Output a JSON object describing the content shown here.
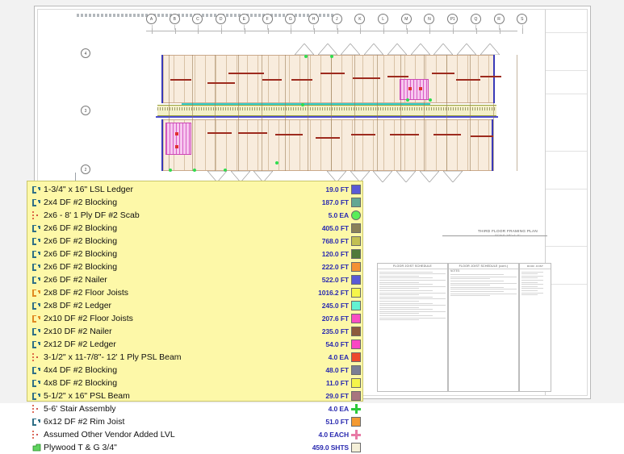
{
  "sheet": {
    "header_note": "",
    "plan_title": "THIRD FLOOR FRAMING PLAN",
    "plan_scale": "SCALE 1/8\"=1'-0\"",
    "grid_labels_horizontal": [
      "A",
      "B",
      "C",
      "D",
      "E",
      "F",
      "G",
      "H",
      "J",
      "K",
      "L",
      "M",
      "N",
      "P1",
      "Q",
      "R",
      "S"
    ],
    "grid_labels_vertical": [
      "4",
      "3",
      "2"
    ],
    "schedules": [
      {
        "title": "FLOOR JOIST SCHEDULE"
      },
      {
        "title": "FLOOR JOIST SCHEDULE (cont.)"
      },
      {
        "title": "ROOF JOIST"
      }
    ],
    "notes_heading": "NOTES:"
  },
  "legend": {
    "panel_title": "",
    "rows": [
      {
        "icon": "linear-member-icon",
        "icon_style": "line",
        "label": "1-3/4\" x 16\" LSL Ledger",
        "value": "19.0 FT",
        "swatch": "#5a5ad6",
        "swatch_shape": "square"
      },
      {
        "icon": "linear-member-icon",
        "icon_style": "line",
        "label": "2x4 DF #2 Blocking",
        "value": "187.0 FT",
        "swatch": "#63a893",
        "swatch_shape": "square"
      },
      {
        "icon": "point-member-icon",
        "icon_style": "point",
        "label": "2x6 - 8' 1 Ply DF #2 Scab",
        "value": "5.0 EA",
        "swatch": "#58ee58",
        "swatch_shape": "circle"
      },
      {
        "icon": "linear-member-icon",
        "icon_style": "line",
        "label": "2x6 DF #2 Blocking",
        "value": "405.0 FT",
        "swatch": "#8a8158",
        "swatch_shape": "square"
      },
      {
        "icon": "linear-member-icon",
        "icon_style": "line",
        "label": "2x6 DF #2 Blocking",
        "value": "768.0 FT",
        "swatch": "#c2bf52",
        "swatch_shape": "square"
      },
      {
        "icon": "linear-member-icon",
        "icon_style": "line",
        "label": "2x6 DF #2 Blocking",
        "value": "120.0 FT",
        "swatch": "#4f7a3a",
        "swatch_shape": "square"
      },
      {
        "icon": "linear-member-icon",
        "icon_style": "line",
        "label": "2x6 DF #2 Blocking",
        "value": "222.0 FT",
        "swatch": "#f49133",
        "swatch_shape": "square"
      },
      {
        "icon": "linear-member-icon",
        "icon_style": "line",
        "label": "2x6 DF #2 Nailer",
        "value": "522.0 FT",
        "swatch": "#5a5ad6",
        "swatch_shape": "square"
      },
      {
        "icon": "linear-member-icon",
        "icon_style": "line-orange",
        "label": "2x8 DF #2 Floor Joists",
        "value": "1016.2 FT",
        "swatch": "#f6f64a",
        "swatch_shape": "square"
      },
      {
        "icon": "linear-member-icon",
        "icon_style": "line",
        "label": "2x8 DF #2 Ledger",
        "value": "245.0 FT",
        "swatch": "#63f2d2",
        "swatch_shape": "square"
      },
      {
        "icon": "linear-member-icon",
        "icon_style": "line-orange",
        "label": "2x10 DF #2 Floor Joists",
        "value": "207.6 FT",
        "swatch": "#f94ec2",
        "swatch_shape": "square"
      },
      {
        "icon": "linear-member-icon",
        "icon_style": "line",
        "label": "2x10 DF #2 Nailer",
        "value": "235.0 FT",
        "swatch": "#8d5a3c",
        "swatch_shape": "square"
      },
      {
        "icon": "linear-member-icon",
        "icon_style": "line",
        "label": "2x12 DF #2 Ledger",
        "value": "54.0 FT",
        "swatch": "#fa46c4",
        "swatch_shape": "square"
      },
      {
        "icon": "point-member-icon",
        "icon_style": "point",
        "label": "3-1/2\" x 11-7/8\"- 12' 1 Ply PSL Beam",
        "value": "4.0 EA",
        "swatch": "#ee4a2c",
        "swatch_shape": "square"
      },
      {
        "icon": "linear-member-icon",
        "icon_style": "line",
        "label": "4x4 DF #2 Blocking",
        "value": "48.0 FT",
        "swatch": "#7b7f94",
        "swatch_shape": "square"
      },
      {
        "icon": "linear-member-icon",
        "icon_style": "line",
        "label": "4x8 DF #2 Blocking",
        "value": "11.0 FT",
        "swatch": "#f4f44a",
        "swatch_shape": "square"
      },
      {
        "icon": "linear-member-icon",
        "icon_style": "line",
        "label": "5-1/2\" x 16\" PSL Beam",
        "value": "29.0 FT",
        "swatch": "#a8757e",
        "swatch_shape": "square"
      },
      {
        "icon": "point-member-icon",
        "icon_style": "point",
        "label": "5-6' Stair Assembly",
        "value": "4.0 EA",
        "swatch": "#2cc93a",
        "swatch_shape": "cross"
      },
      {
        "icon": "linear-member-icon",
        "icon_style": "line",
        "label": "6x12 DF #2 Rim Joist",
        "value": "51.0 FT",
        "swatch": "#f49a33",
        "swatch_shape": "square"
      },
      {
        "icon": "point-member-icon",
        "icon_style": "point",
        "label": "Assumed Other Vendor Added LVL",
        "value": "4.0 EACH",
        "swatch": "#e87aa6",
        "swatch_shape": "cross"
      },
      {
        "icon": "area-member-icon",
        "icon_style": "area",
        "label": "Plywood T & G 3/4\"",
        "value": "459.0 SHTS",
        "swatch": "#f5f0d8",
        "swatch_shape": "square"
      }
    ]
  },
  "colors": {
    "legend_bg": "#fdf8a8",
    "legend_border": "#c9c56a",
    "value_text": "#2a2ab0",
    "plan_fill": "#f8ecdd",
    "beam_red": "#9d2b1e"
  }
}
